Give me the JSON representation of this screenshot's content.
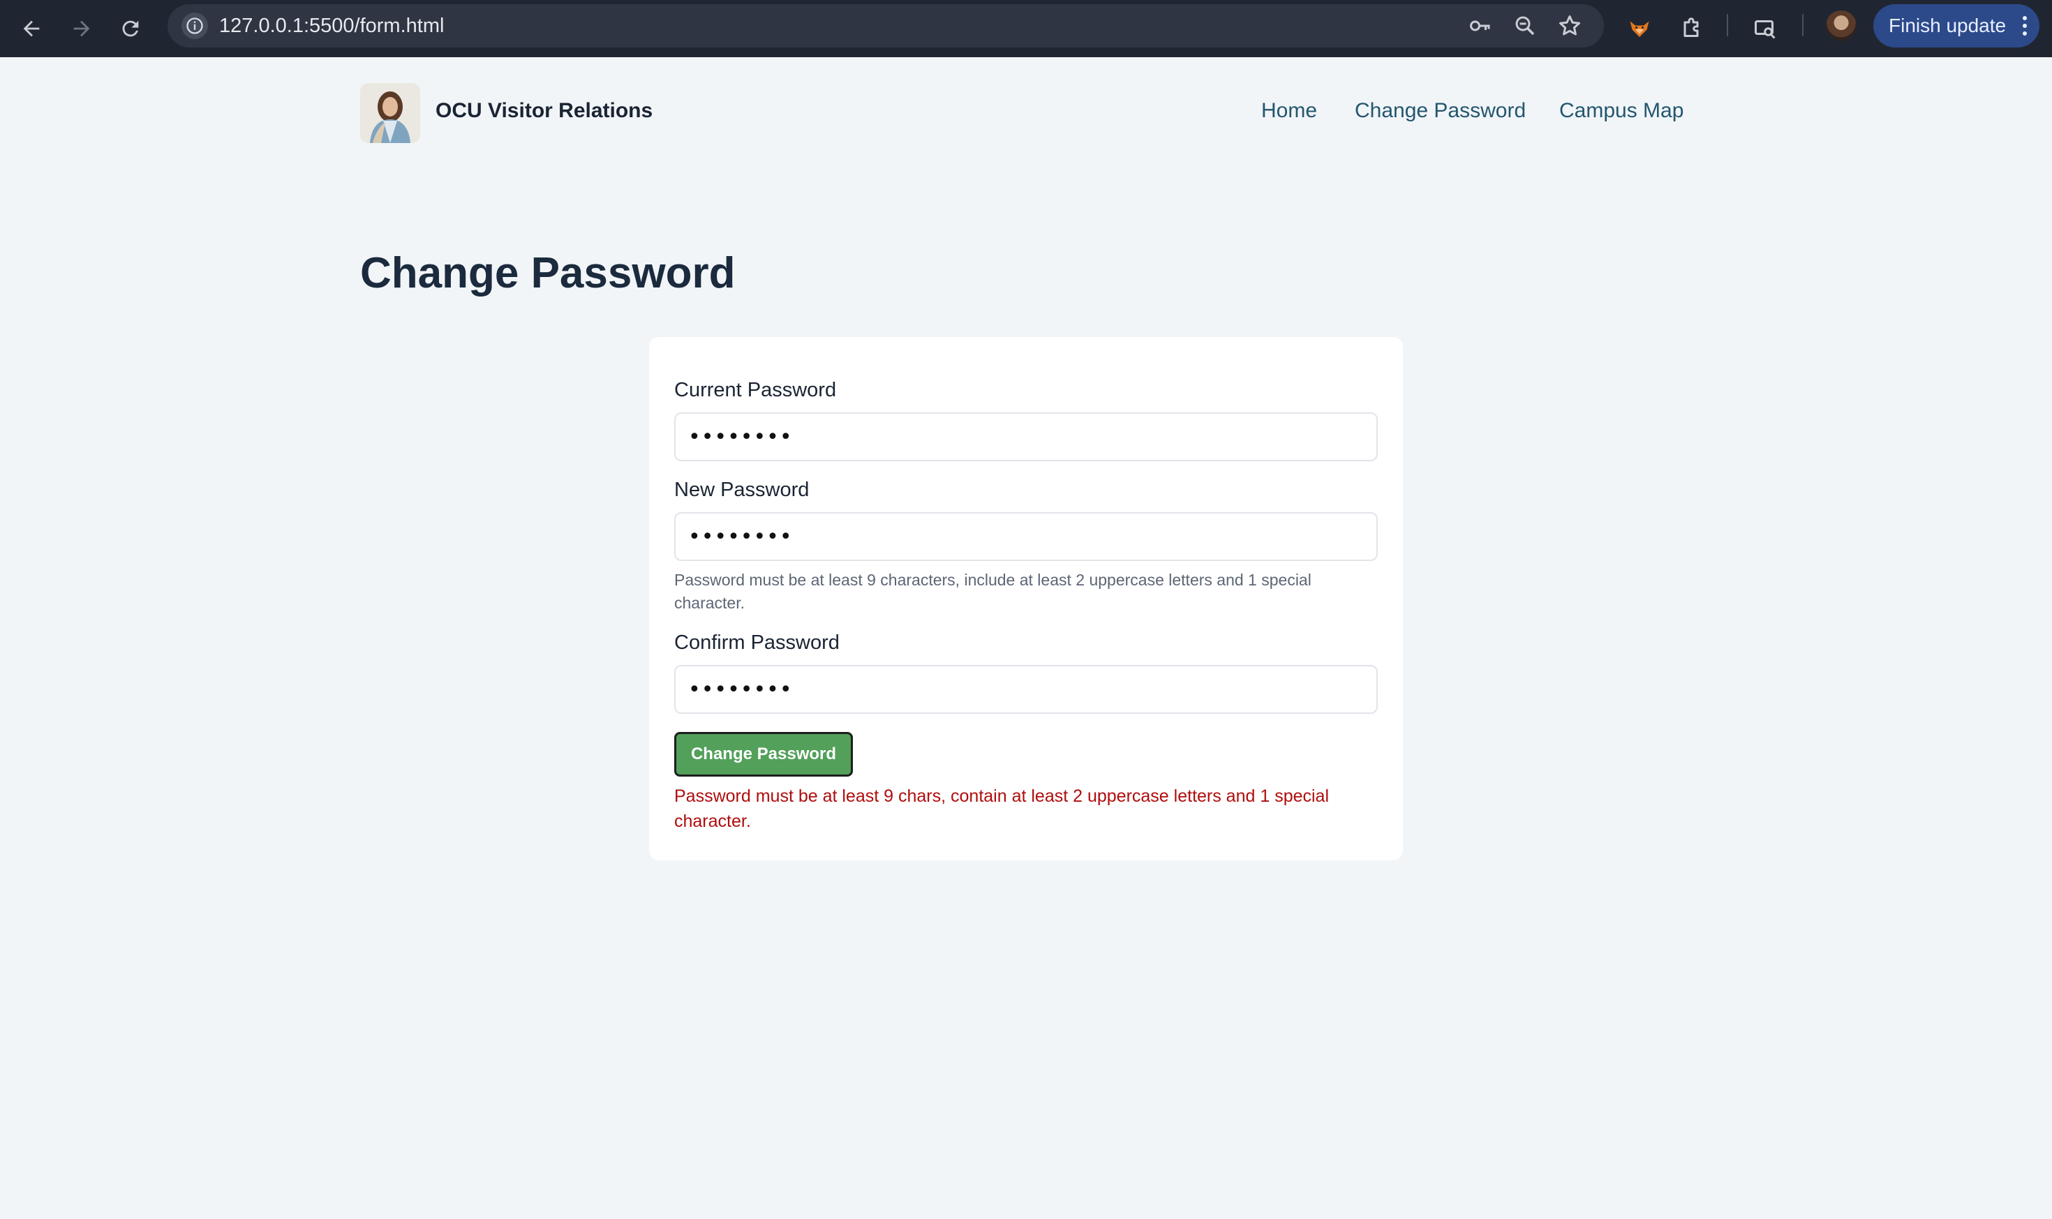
{
  "browser": {
    "url": "127.0.0.1:5500/form.html",
    "finish_update_label": "Finish update",
    "icons": [
      "back-arrow-icon",
      "forward-arrow-icon",
      "reload-icon",
      "info-icon",
      "key-icon",
      "zoom-icon",
      "star-icon",
      "fox-extension-icon",
      "extensions-puzzle-icon",
      "cast-search-icon",
      "profile-avatar",
      "more-vert-icon"
    ]
  },
  "header": {
    "brand": "OCU Visitor Relations",
    "nav": [
      {
        "label": "Home"
      },
      {
        "label": "Change Password"
      },
      {
        "label": "Campus Map"
      }
    ]
  },
  "main": {
    "title": "Change Password"
  },
  "form": {
    "current": {
      "label": "Current Password",
      "value": "••••••••"
    },
    "new": {
      "label": "New Password",
      "value": "••••••••"
    },
    "hint": "Password must be at least 9 characters, include at least 2 uppercase letters and 1 special character.",
    "confirm": {
      "label": "Confirm Password",
      "value": "••••••••"
    },
    "submit_label": "Change Password",
    "error": "Password must be at least 9 chars, contain at least 2 uppercase letters and 1 special character."
  },
  "colors": {
    "accent_green": "#52a05a",
    "error_red": "#b00d0d",
    "nav_link": "#24566e",
    "page_bg": "#f1f5f8"
  }
}
